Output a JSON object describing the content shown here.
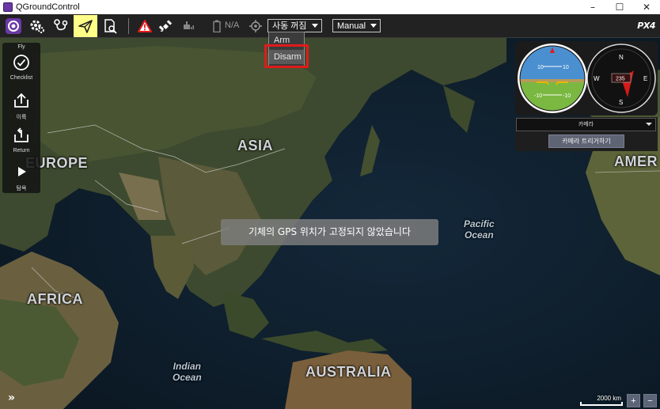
{
  "window": {
    "title": "QGroundControl",
    "buttons": [
      "–",
      "☐",
      "✕"
    ]
  },
  "toolbar": {
    "icons": [
      "app-logo-icon",
      "gear-icon",
      "route-icon",
      "paper-plane-icon",
      "analyze-icon",
      "warning-icon",
      "satellite-icon",
      "drone-icon",
      "battery-icon",
      "gps-target-icon"
    ],
    "battery_text": "N/A",
    "flight_mode_label": "사동 꺼짐",
    "mode_label": "Manual",
    "brand": "PX4"
  },
  "dropdown": {
    "items": [
      "Arm",
      "Disarm"
    ]
  },
  "toolstrip": {
    "header": "Fly",
    "items": [
      {
        "label": "Checklist",
        "icon": "check-circle-icon"
      },
      {
        "label": "이륙",
        "icon": "takeoff-icon"
      },
      {
        "label": "Return",
        "icon": "return-icon"
      },
      {
        "label": "탐욕",
        "icon": "play-icon"
      }
    ]
  },
  "map": {
    "continents": [
      "ASIA",
      "EUROPE",
      "AFRICA",
      "AUSTRALIA",
      "AMER"
    ],
    "oceans": [
      "Pacific\nOcean",
      "Indian\nOcean"
    ]
  },
  "instruments": {
    "attitude_ticks": [
      "10",
      "10",
      "-10",
      "-10"
    ],
    "compass": {
      "n": "N",
      "e": "E",
      "s": "S",
      "w": "W",
      "heading": "235"
    }
  },
  "camera": {
    "select_label": "카메라",
    "trigger_label": "카메라 트리거하기"
  },
  "message": "기체의 GPS 위치가 고정되지 않았습니다",
  "map_controls": {
    "scale_label": "2000 km",
    "zoom_in": "+",
    "zoom_out": "−",
    "expand": "»"
  },
  "colors": {
    "toolbar_bg": "#222222",
    "active_tool": "#ffff88",
    "warning": "#e11a1a",
    "sky": "#4a8fd0",
    "ground": "#7ab842"
  }
}
